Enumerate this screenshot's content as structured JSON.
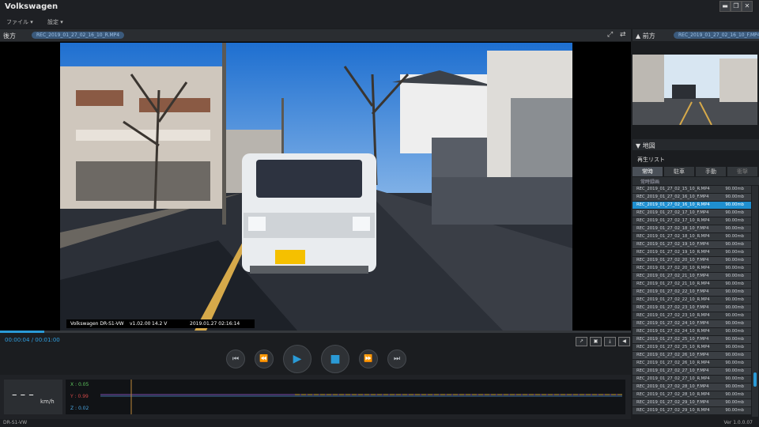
{
  "app": {
    "title": "Volkswagen"
  },
  "window_controls": {
    "menu": "▬",
    "restore": "❐",
    "close": "✕"
  },
  "menu": {
    "file": "ファイル ▾",
    "settings": "設定 ▾"
  },
  "rear": {
    "label": "後方",
    "filename": "REC_2019_01_27_02_16_10_R.MP4"
  },
  "front": {
    "label": "▲ 前方",
    "filename": "REC_2019_01_27_02_16_10_F.MP4"
  },
  "osd": {
    "model": "Volkswagen DR-S1-VW",
    "version": "v1.02.00",
    "voltage": "14.2 V",
    "datetime": "2019.01.27 02:16:14"
  },
  "playback": {
    "position": "00:00:04",
    "duration": "00:01:00",
    "progress": 0.07
  },
  "sensor": {
    "speed": "– – –",
    "speed_unit": "km/h",
    "x": "X : 0.05",
    "y": "Y : 0.99",
    "z": "Z : 0.02"
  },
  "map": {
    "label": "▼ 地図"
  },
  "playlist": {
    "title": "再生リスト",
    "tabs": [
      "常時",
      "駐車",
      "手動",
      "衝撃"
    ],
    "subtab": "常時録画",
    "selected_index": 2,
    "size": "90.00mb",
    "files": [
      "REC_2019_01_27_02_15_10_R.MP4",
      "REC_2019_01_27_02_16_10_F.MP4",
      "REC_2019_01_27_02_16_10_R.MP4",
      "REC_2019_01_27_02_17_10_F.MP4",
      "REC_2019_01_27_02_17_10_R.MP4",
      "REC_2019_01_27_02_18_10_F.MP4",
      "REC_2019_01_27_02_18_10_R.MP4",
      "REC_2019_01_27_02_19_10_F.MP4",
      "REC_2019_01_27_02_19_10_R.MP4",
      "REC_2019_01_27_02_20_10_F.MP4",
      "REC_2019_01_27_02_20_10_R.MP4",
      "REC_2019_01_27_02_21_10_F.MP4",
      "REC_2019_01_27_02_21_10_R.MP4",
      "REC_2019_01_27_02_22_10_F.MP4",
      "REC_2019_01_27_02_22_10_R.MP4",
      "REC_2019_01_27_02_23_10_F.MP4",
      "REC_2019_01_27_02_23_10_R.MP4",
      "REC_2019_01_27_02_24_10_F.MP4",
      "REC_2019_01_27_02_24_10_R.MP4",
      "REC_2019_01_27_02_25_10_F.MP4",
      "REC_2019_01_27_02_25_10_R.MP4",
      "REC_2019_01_27_02_26_10_F.MP4",
      "REC_2019_01_27_02_26_10_R.MP4",
      "REC_2019_01_27_02_27_10_F.MP4",
      "REC_2019_01_27_02_27_10_R.MP4",
      "REC_2019_01_27_02_28_10_F.MP4",
      "REC_2019_01_27_02_28_10_R.MP4",
      "REC_2019_01_27_02_29_10_F.MP4",
      "REC_2019_01_27_02_29_10_R.MP4"
    ]
  },
  "status": {
    "device": "DR-S1-VW",
    "version": "Ver 1.0.0.07"
  },
  "colors": {
    "accent": "#2a9ad6",
    "selected_row": "#1f8fd0"
  }
}
